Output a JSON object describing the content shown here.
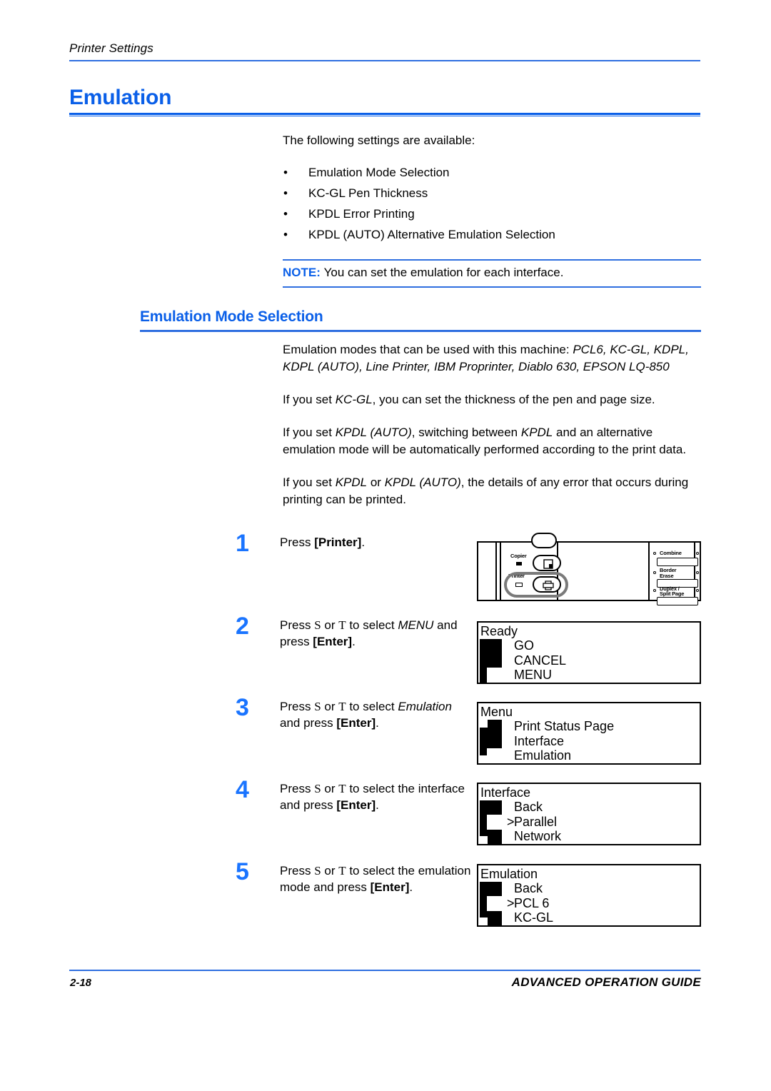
{
  "colors": {
    "heading_blue": "#0a5fe8",
    "rule_blue": "#2f6fe0",
    "step_number_blue": "#1a74ff",
    "text_black": "#000000",
    "page_background": "#ffffff",
    "highlight_gray": "#7a7a7a"
  },
  "running_head": "Printer Settings",
  "heading": "Emulation",
  "intro": "The following settings are available:",
  "bullet_marker": "•",
  "bullets": [
    "Emulation Mode Selection",
    "KC-GL Pen Thickness",
    "KPDL Error Printing",
    "KPDL (AUTO) Alternative Emulation Selection"
  ],
  "note": {
    "label": "NOTE:",
    "text": "You can set the emulation for each interface."
  },
  "subheading": "Emulation Mode Selection",
  "paragraphs": [
    {
      "id": "modes",
      "lead": "Emulation modes that can be used with this machine: ",
      "emphasis": "PCL6, KC-GL, KDPL, KDPL (AUTO), Line Printer, IBM Proprinter, Diablo 630, EPSON LQ-850"
    },
    {
      "id": "kcgl",
      "segments": [
        "If you set ",
        "KC-GL",
        ", you can set the thickness of the pen and page size."
      ]
    },
    {
      "id": "kpdl-auto",
      "segments": [
        "If you set ",
        "KPDL (AUTO)",
        ", switching between ",
        "KPDL",
        " and an alternative emulation mode will be automatically performed according to the print data."
      ]
    },
    {
      "id": "kpdl-error",
      "segments": [
        "If you set ",
        "KPDL",
        " or ",
        "KPDL (AUTO)",
        ", the details of any error that occurs during printing can be printed."
      ]
    }
  ],
  "arrow_up_glyph": "S",
  "arrow_down_glyph": "T",
  "steps": [
    {
      "number": "1",
      "text_parts": [
        {
          "t": "Press ",
          "b": false
        },
        {
          "t": "[Printer]",
          "b": true
        },
        {
          "t": ".",
          "b": false
        }
      ]
    },
    {
      "number": "2",
      "text_parts": [
        {
          "t": "Press ",
          "b": false
        },
        {
          "t": "S",
          "b": false,
          "arrow": true
        },
        {
          "t": " or ",
          "b": false
        },
        {
          "t": "T",
          "b": false,
          "arrow": true
        },
        {
          "t": " to select ",
          "b": false
        },
        {
          "t": "MENU",
          "b": false,
          "i": true
        },
        {
          "t": " and press ",
          "b": false
        },
        {
          "t": "[Enter]",
          "b": true
        },
        {
          "t": ".",
          "b": false
        }
      ]
    },
    {
      "number": "3",
      "text_parts": [
        {
          "t": "Press ",
          "b": false
        },
        {
          "t": "S",
          "b": false,
          "arrow": true
        },
        {
          "t": " or ",
          "b": false
        },
        {
          "t": "T",
          "b": false,
          "arrow": true
        },
        {
          "t": " to select ",
          "b": false
        },
        {
          "t": "Emulation",
          "b": false,
          "i": true
        },
        {
          "t": " and press ",
          "b": false
        },
        {
          "t": "[Enter]",
          "b": true
        },
        {
          "t": ".",
          "b": false
        }
      ]
    },
    {
      "number": "4",
      "text_parts": [
        {
          "t": "Press ",
          "b": false
        },
        {
          "t": "S",
          "b": false,
          "arrow": true
        },
        {
          "t": " or ",
          "b": false
        },
        {
          "t": "T",
          "b": false,
          "arrow": true
        },
        {
          "t": " to select the interface and press ",
          "b": false
        },
        {
          "t": "[Enter]",
          "b": true
        },
        {
          "t": ".",
          "b": false
        }
      ]
    },
    {
      "number": "5",
      "text_parts": [
        {
          "t": "Press ",
          "b": false
        },
        {
          "t": "S",
          "b": false,
          "arrow": true
        },
        {
          "t": " or ",
          "b": false
        },
        {
          "t": "T",
          "b": false,
          "arrow": true
        },
        {
          "t": " to select the emulation mode and press ",
          "b": false
        },
        {
          "t": "[Enter]",
          "b": true
        },
        {
          "t": ".",
          "b": false
        }
      ]
    }
  ],
  "control_panel": {
    "buttons": [
      {
        "label": "Copier",
        "icon": "copier-icon",
        "highlighted": false
      },
      {
        "label": "Printer",
        "icon": "printer-icon",
        "highlighted": true
      }
    ],
    "right_buttons": [
      {
        "label": "Combine"
      },
      {
        "label": "Border Erase"
      },
      {
        "label": "Duplex / Split Page"
      }
    ]
  },
  "lcd_panels": [
    {
      "id": "ready",
      "title": "Ready",
      "rows": [
        {
          "label": "GO",
          "selected": false
        },
        {
          "label": "CANCEL",
          "selected": false
        },
        {
          "label": "MENU",
          "selected": false
        }
      ],
      "cursor_row": 2,
      "top_marker": false,
      "bottom_marker": false
    },
    {
      "id": "menu",
      "title": "Menu",
      "rows": [
        {
          "label": "Print Status Page",
          "selected": false
        },
        {
          "label": "Interface",
          "selected": false
        },
        {
          "label": "Emulation",
          "selected": false
        }
      ],
      "cursor_row": 2,
      "top_marker": true,
      "bottom_marker": true
    },
    {
      "id": "interface",
      "title": "Interface",
      "rows": [
        {
          "label": "Back",
          "selected": false
        },
        {
          "label": "Parallel",
          "selected": true
        },
        {
          "label": "Network",
          "selected": false
        }
      ],
      "cursor_row": 1,
      "top_marker": false,
      "bottom_marker": true
    },
    {
      "id": "emulation",
      "title": "Emulation",
      "rows": [
        {
          "label": "Back",
          "selected": false
        },
        {
          "label": "PCL 6",
          "selected": true
        },
        {
          "label": "KC-GL",
          "selected": false
        }
      ],
      "cursor_row": 1,
      "top_marker": false,
      "bottom_marker": true
    }
  ],
  "selection_marker": ">",
  "footer": {
    "page_number": "2-18",
    "guide_title": "ADVANCED OPERATION GUIDE"
  }
}
